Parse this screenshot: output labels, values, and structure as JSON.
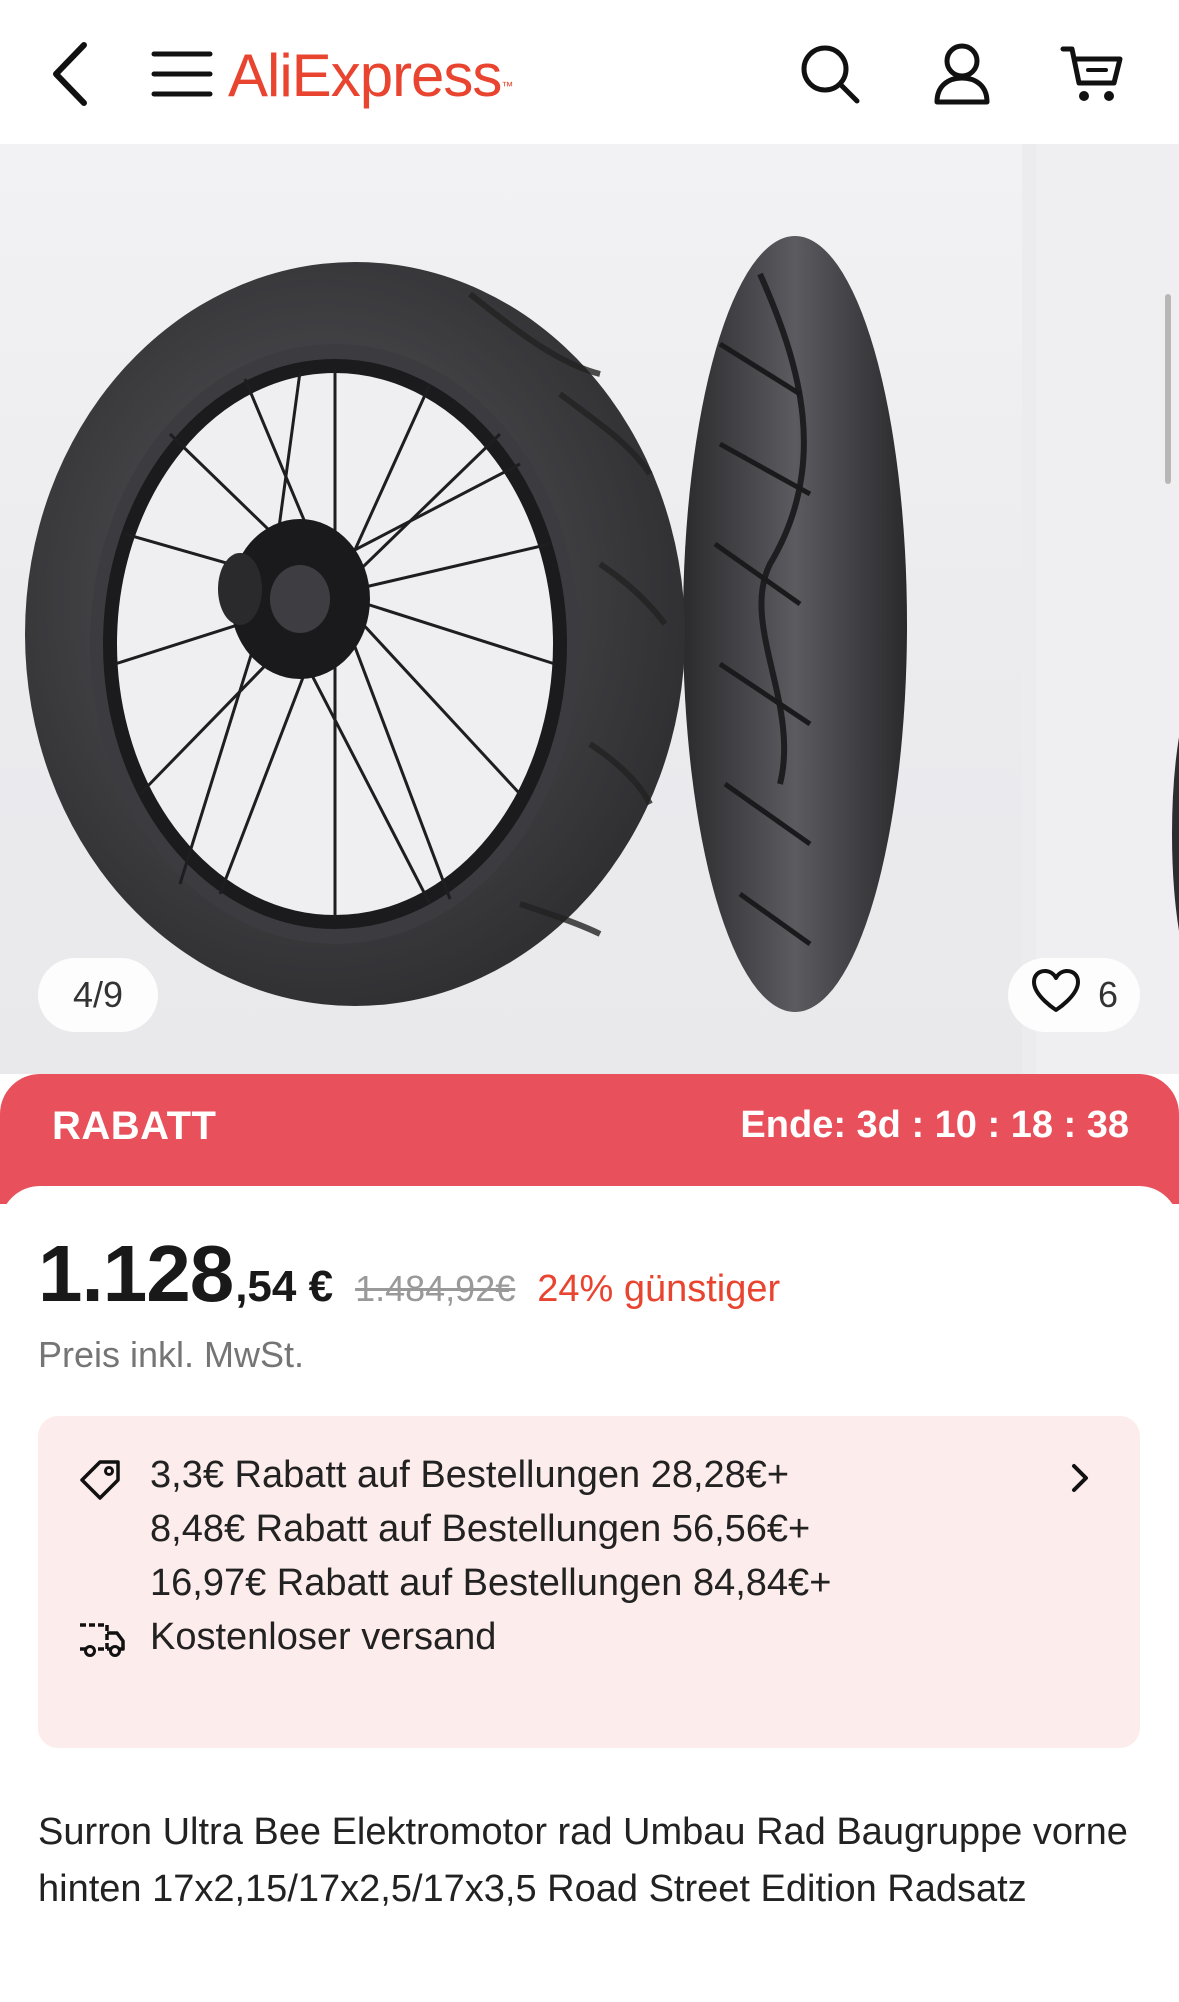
{
  "header": {
    "logo_text": "AliExpress",
    "brand_color": "#e8442f",
    "icons": [
      "back-arrow-icon",
      "menu-icon",
      "search-icon",
      "account-icon",
      "cart-icon"
    ]
  },
  "gallery": {
    "counter": "4/9",
    "wishlist_count": "6"
  },
  "banner": {
    "label": "RABATT",
    "timer": "Ende: 3d : 10 : 18 : 38",
    "color": "#e8505b"
  },
  "price": {
    "integer": "1.128",
    "decimal": ",54 €",
    "original": "1.484,92€",
    "discount": "24% günstiger",
    "vat_note": "Preis inkl. MwSt."
  },
  "promo": {
    "lines": [
      "3,3€ Rabatt auf Bestellungen 28,28€+",
      "8,48€ Rabatt auf Bestellungen 56,56€+",
      "16,97€ Rabatt auf Bestellungen 84,84€+"
    ],
    "shipping": "Kostenloser versand",
    "background": "#fdecec"
  },
  "product": {
    "title": "Surron Ultra Bee Elektromotor rad Umbau Rad Baugruppe vorne hinten 17x2,15/17x2,5/17x3,5 Road Street Edition Radsatz"
  }
}
